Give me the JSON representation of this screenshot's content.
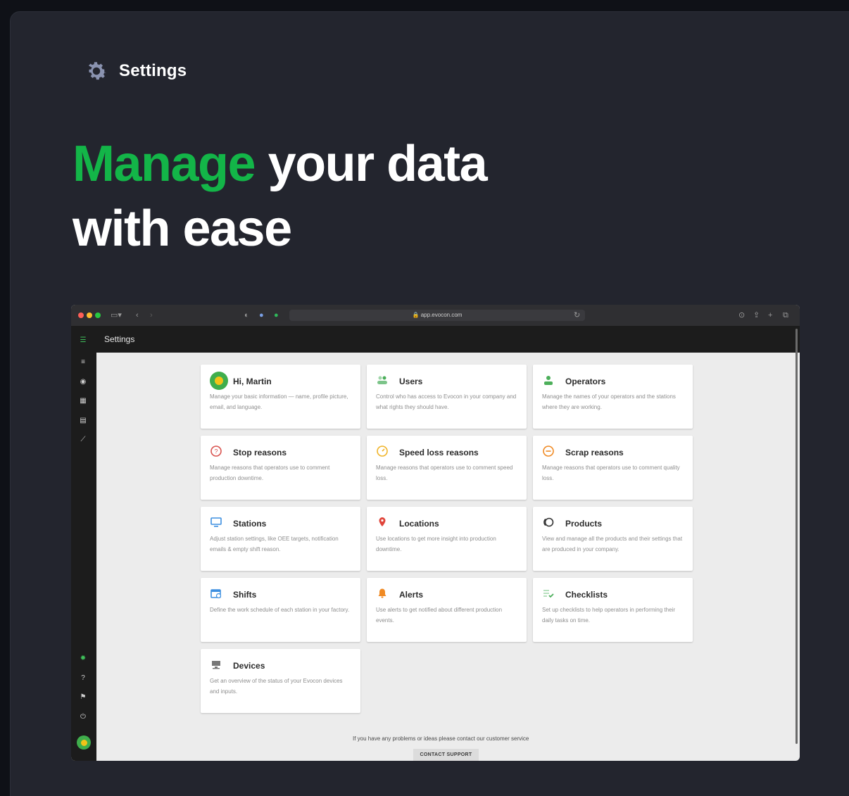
{
  "header": {
    "section_label": "Settings"
  },
  "hero": {
    "accent": "Manage",
    "rest_line1": " your data",
    "line2": "with ease"
  },
  "browser": {
    "url": "app.evocon.com",
    "app_title": "Settings"
  },
  "cards": [
    {
      "title": "Hi, Martin",
      "desc": "Manage your basic information — name, profile picture, email, and language.",
      "icon": "user-avatar-icon"
    },
    {
      "title": "Users",
      "desc": "Control who has access to Evocon in your company and what rights they should have.",
      "icon": "users-icon"
    },
    {
      "title": "Operators",
      "desc": "Manage the names of your operators and the stations where they are working.",
      "icon": "operator-icon"
    },
    {
      "title": "Stop reasons",
      "desc": "Manage reasons that operators use to comment production downtime.",
      "icon": "stop-reason-icon"
    },
    {
      "title": "Speed loss reasons",
      "desc": "Manage reasons that operators use to comment speed loss.",
      "icon": "speed-loss-icon"
    },
    {
      "title": "Scrap reasons",
      "desc": "Manage reasons that operators use to comment quality loss.",
      "icon": "scrap-icon"
    },
    {
      "title": "Stations",
      "desc": "Adjust station settings, like OEE targets, notification emails & empty shift reason.",
      "icon": "monitor-icon"
    },
    {
      "title": "Locations",
      "desc": "Use locations to get more insight into production downtime.",
      "icon": "location-pin-icon"
    },
    {
      "title": "Products",
      "desc": "View and manage all the products and their settings that are produced in your company.",
      "icon": "products-icon"
    },
    {
      "title": "Shifts",
      "desc": "Define the work schedule of each station in your factory.",
      "icon": "calendar-icon"
    },
    {
      "title": "Alerts",
      "desc": "Use alerts to get notified about different production events.",
      "icon": "bell-icon"
    },
    {
      "title": "Checklists",
      "desc": "Set up checklists to help operators in performing their daily tasks on time.",
      "icon": "checklist-icon"
    },
    {
      "title": "Devices",
      "desc": "Get an overview of the status of your Evocon devices and inputs.",
      "icon": "device-icon"
    }
  ],
  "footer": {
    "text": "If you have any problems or ideas please contact our customer service",
    "button": "CONTACT SUPPORT"
  },
  "colors": {
    "accent_green": "#13b548",
    "panel": "#23252e"
  }
}
